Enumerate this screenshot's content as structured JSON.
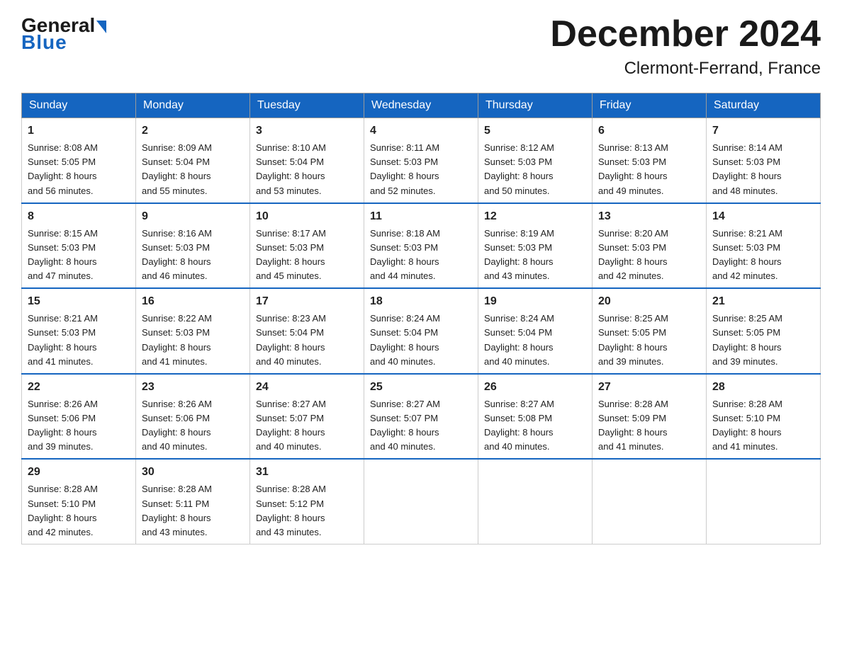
{
  "logo": {
    "general_text": "General",
    "blue_text": "Blue"
  },
  "title": "December 2024",
  "subtitle": "Clermont-Ferrand, France",
  "days_of_week": [
    "Sunday",
    "Monday",
    "Tuesday",
    "Wednesday",
    "Thursday",
    "Friday",
    "Saturday"
  ],
  "weeks": [
    [
      {
        "day": 1,
        "sunrise": "8:08 AM",
        "sunset": "5:05 PM",
        "daylight": "8 hours and 56 minutes."
      },
      {
        "day": 2,
        "sunrise": "8:09 AM",
        "sunset": "5:04 PM",
        "daylight": "8 hours and 55 minutes."
      },
      {
        "day": 3,
        "sunrise": "8:10 AM",
        "sunset": "5:04 PM",
        "daylight": "8 hours and 53 minutes."
      },
      {
        "day": 4,
        "sunrise": "8:11 AM",
        "sunset": "5:03 PM",
        "daylight": "8 hours and 52 minutes."
      },
      {
        "day": 5,
        "sunrise": "8:12 AM",
        "sunset": "5:03 PM",
        "daylight": "8 hours and 50 minutes."
      },
      {
        "day": 6,
        "sunrise": "8:13 AM",
        "sunset": "5:03 PM",
        "daylight": "8 hours and 49 minutes."
      },
      {
        "day": 7,
        "sunrise": "8:14 AM",
        "sunset": "5:03 PM",
        "daylight": "8 hours and 48 minutes."
      }
    ],
    [
      {
        "day": 8,
        "sunrise": "8:15 AM",
        "sunset": "5:03 PM",
        "daylight": "8 hours and 47 minutes."
      },
      {
        "day": 9,
        "sunrise": "8:16 AM",
        "sunset": "5:03 PM",
        "daylight": "8 hours and 46 minutes."
      },
      {
        "day": 10,
        "sunrise": "8:17 AM",
        "sunset": "5:03 PM",
        "daylight": "8 hours and 45 minutes."
      },
      {
        "day": 11,
        "sunrise": "8:18 AM",
        "sunset": "5:03 PM",
        "daylight": "8 hours and 44 minutes."
      },
      {
        "day": 12,
        "sunrise": "8:19 AM",
        "sunset": "5:03 PM",
        "daylight": "8 hours and 43 minutes."
      },
      {
        "day": 13,
        "sunrise": "8:20 AM",
        "sunset": "5:03 PM",
        "daylight": "8 hours and 42 minutes."
      },
      {
        "day": 14,
        "sunrise": "8:21 AM",
        "sunset": "5:03 PM",
        "daylight": "8 hours and 42 minutes."
      }
    ],
    [
      {
        "day": 15,
        "sunrise": "8:21 AM",
        "sunset": "5:03 PM",
        "daylight": "8 hours and 41 minutes."
      },
      {
        "day": 16,
        "sunrise": "8:22 AM",
        "sunset": "5:03 PM",
        "daylight": "8 hours and 41 minutes."
      },
      {
        "day": 17,
        "sunrise": "8:23 AM",
        "sunset": "5:04 PM",
        "daylight": "8 hours and 40 minutes."
      },
      {
        "day": 18,
        "sunrise": "8:24 AM",
        "sunset": "5:04 PM",
        "daylight": "8 hours and 40 minutes."
      },
      {
        "day": 19,
        "sunrise": "8:24 AM",
        "sunset": "5:04 PM",
        "daylight": "8 hours and 40 minutes."
      },
      {
        "day": 20,
        "sunrise": "8:25 AM",
        "sunset": "5:05 PM",
        "daylight": "8 hours and 39 minutes."
      },
      {
        "day": 21,
        "sunrise": "8:25 AM",
        "sunset": "5:05 PM",
        "daylight": "8 hours and 39 minutes."
      }
    ],
    [
      {
        "day": 22,
        "sunrise": "8:26 AM",
        "sunset": "5:06 PM",
        "daylight": "8 hours and 39 minutes."
      },
      {
        "day": 23,
        "sunrise": "8:26 AM",
        "sunset": "5:06 PM",
        "daylight": "8 hours and 40 minutes."
      },
      {
        "day": 24,
        "sunrise": "8:27 AM",
        "sunset": "5:07 PM",
        "daylight": "8 hours and 40 minutes."
      },
      {
        "day": 25,
        "sunrise": "8:27 AM",
        "sunset": "5:07 PM",
        "daylight": "8 hours and 40 minutes."
      },
      {
        "day": 26,
        "sunrise": "8:27 AM",
        "sunset": "5:08 PM",
        "daylight": "8 hours and 40 minutes."
      },
      {
        "day": 27,
        "sunrise": "8:28 AM",
        "sunset": "5:09 PM",
        "daylight": "8 hours and 41 minutes."
      },
      {
        "day": 28,
        "sunrise": "8:28 AM",
        "sunset": "5:10 PM",
        "daylight": "8 hours and 41 minutes."
      }
    ],
    [
      {
        "day": 29,
        "sunrise": "8:28 AM",
        "sunset": "5:10 PM",
        "daylight": "8 hours and 42 minutes."
      },
      {
        "day": 30,
        "sunrise": "8:28 AM",
        "sunset": "5:11 PM",
        "daylight": "8 hours and 43 minutes."
      },
      {
        "day": 31,
        "sunrise": "8:28 AM",
        "sunset": "5:12 PM",
        "daylight": "8 hours and 43 minutes."
      },
      null,
      null,
      null,
      null
    ]
  ],
  "labels": {
    "sunrise_label": "Sunrise:",
    "sunset_label": "Sunset:",
    "daylight_label": "Daylight:"
  }
}
